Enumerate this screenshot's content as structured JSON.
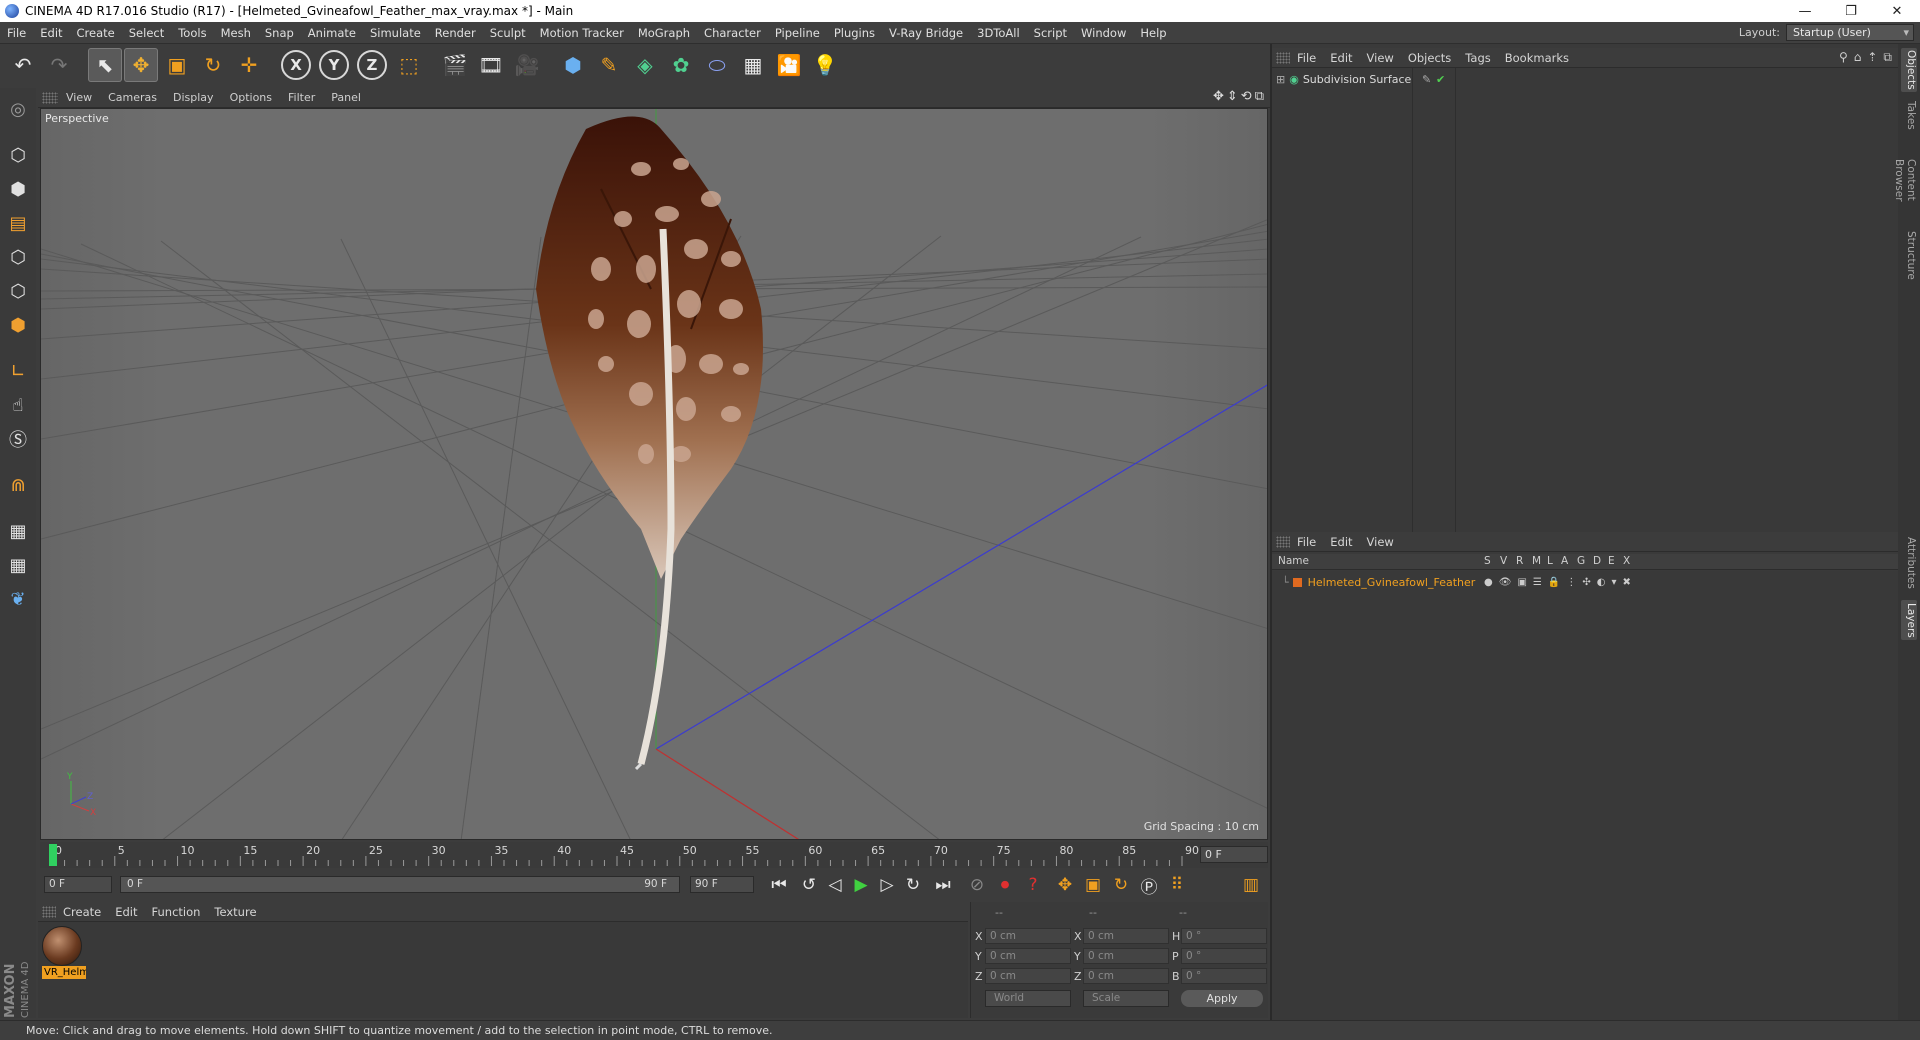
{
  "window": {
    "title": "CINEMA 4D R17.016 Studio (R17) - [Helmeted_Gvineafowl_Feather_max_vray.max *] - Main"
  },
  "menu": [
    "File",
    "Edit",
    "Create",
    "Select",
    "Tools",
    "Mesh",
    "Snap",
    "Animate",
    "Simulate",
    "Render",
    "Sculpt",
    "Motion Tracker",
    "MoGraph",
    "Character",
    "Pipeline",
    "Plugins",
    "V-Ray Bridge",
    "3DToAll",
    "Script",
    "Window",
    "Help"
  ],
  "layout": {
    "label": "Layout:",
    "value": "Startup (User)"
  },
  "toolbar": {
    "axis_x": "X",
    "axis_y": "Y",
    "axis_z": "Z"
  },
  "viewport": {
    "menu": [
      "View",
      "Cameras",
      "Display",
      "Options",
      "Filter",
      "Panel"
    ],
    "label": "Perspective",
    "grid_spacing": "Grid Spacing : 10 cm",
    "axis_x": "X",
    "axis_y": "Y",
    "axis_z": "Z"
  },
  "timeline": {
    "ticks": [
      "0",
      "5",
      "10",
      "15",
      "20",
      "25",
      "30",
      "35",
      "40",
      "45",
      "50",
      "55",
      "60",
      "65",
      "70",
      "75",
      "80",
      "85",
      "90"
    ],
    "current_frame": "0 F",
    "start": "0 F",
    "range_start": "0 F",
    "range_end": "90 F",
    "end": "90 F"
  },
  "materials": {
    "menu": [
      "Create",
      "Edit",
      "Function",
      "Texture"
    ],
    "items": [
      {
        "label": "VR_Helm"
      }
    ]
  },
  "coords": {
    "headers": [
      "--",
      "--",
      "--"
    ],
    "rows": [
      {
        "a1": "X",
        "v1": "0 cm",
        "a2": "X",
        "v2": "0 cm",
        "a3": "H",
        "v3": "0 °"
      },
      {
        "a1": "Y",
        "v1": "0 cm",
        "a2": "Y",
        "v2": "0 cm",
        "a3": "P",
        "v3": "0 °"
      },
      {
        "a1": "Z",
        "v1": "0 cm",
        "a2": "Z",
        "v2": "0 cm",
        "a3": "B",
        "v3": "0 °"
      }
    ],
    "mode_world": "World",
    "mode_scale": "Scale",
    "apply": "Apply"
  },
  "objects_panel": {
    "menu": [
      "File",
      "Edit",
      "View",
      "Objects",
      "Tags",
      "Bookmarks"
    ],
    "items": [
      {
        "name": "Subdivision Surface"
      }
    ]
  },
  "layers_panel": {
    "menu": [
      "File",
      "Edit",
      "View"
    ],
    "columns": [
      "Name",
      "S",
      "V",
      "R",
      "M",
      "L",
      "A",
      "G",
      "D",
      "E",
      "X"
    ],
    "items": [
      {
        "name": "Helmeted_Gvineafowl_Feather",
        "color": "#e06a20"
      }
    ]
  },
  "side_tabs": [
    "Objects",
    "Takes",
    "Content Browser",
    "Structure",
    "Attributes",
    "Layers"
  ],
  "status": "Move: Click and drag to move elements. Hold down SHIFT to quantize movement / add to the selection in point mode, CTRL to remove.",
  "logo": {
    "line1": "MAXON",
    "line2": "CINEMA 4D"
  },
  "colors": {
    "accent": "#f0a020",
    "background": "#3c3c3c",
    "viewport": "#6b6b6b"
  }
}
